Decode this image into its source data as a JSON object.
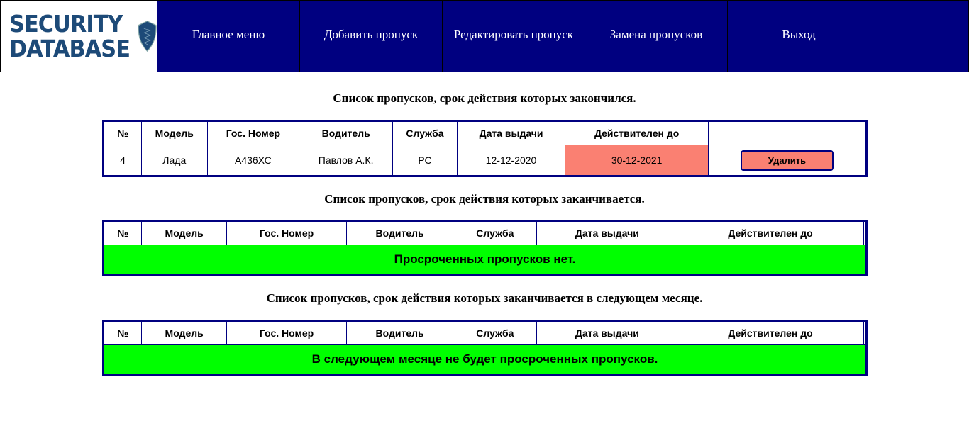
{
  "logo": {
    "text_line1": "SECURITY",
    "text_line2": "DATABASE"
  },
  "nav": [
    "Главное меню",
    "Добавить пропуск",
    "Редактировать пропуск",
    "Замена пропусков",
    "Выход"
  ],
  "columns": [
    "№",
    "Модель",
    "Гос. Номер",
    "Водитель",
    "Служба",
    "Дата выдачи",
    "Действителен до",
    ""
  ],
  "sections": [
    {
      "title": "Список пропусков, срок действия которых закончился.",
      "rows": [
        {
          "num": "4",
          "model": "Лада",
          "plate": "А436ХС",
          "driver": "Павлов А.К.",
          "service": "РС",
          "issued": "12-12-2020",
          "valid_until": "30-12-2021",
          "action": "Удалить"
        }
      ]
    },
    {
      "title": "Список пропусков, срок действия которых заканчивается.",
      "empty_message": "Просроченных пропусков нет."
    },
    {
      "title": "Список пропусков, срок действия которых заканчивается в следующем месяце.",
      "empty_message": "В следующем месяце не будет просроченных пропусков."
    }
  ],
  "colors": {
    "nav": "#000080",
    "expired": "#fa8072",
    "empty": "#00ff00"
  }
}
